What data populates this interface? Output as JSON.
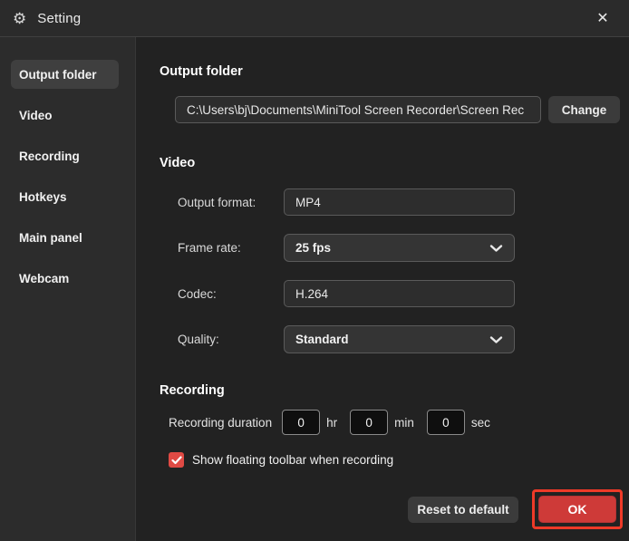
{
  "window": {
    "title": "Setting",
    "gear_icon": "gear",
    "close_icon": "close"
  },
  "colors": {
    "titlebar_bg": "#2b2b2b",
    "sidebar_bg": "#2c2c2c",
    "content_bg": "#222222",
    "selected_item_bg": "#3f3f3f",
    "accent_red": "#ce3a38",
    "checkbox_red": "#e04a44",
    "annotation_red": "#ee3a28"
  },
  "sidebar": {
    "items": [
      {
        "label": "Output folder",
        "selected": true
      },
      {
        "label": "Video",
        "selected": false
      },
      {
        "label": "Recording",
        "selected": false
      },
      {
        "label": "Hotkeys",
        "selected": false
      },
      {
        "label": "Main panel",
        "selected": false
      },
      {
        "label": "Webcam",
        "selected": false
      }
    ]
  },
  "output_folder_section": {
    "heading": "Output folder",
    "path_value": "C:\\Users\\bj\\Documents\\MiniTool Screen Recorder\\Screen Rec",
    "change_button": "Change"
  },
  "video_section": {
    "heading": "Video",
    "rows": [
      {
        "label": "Output format:",
        "value": "MP4",
        "type": "input"
      },
      {
        "label": "Frame rate:",
        "value": "25 fps",
        "type": "dropdown"
      },
      {
        "label": "Codec:",
        "value": "H.264",
        "type": "input"
      },
      {
        "label": "Quality:",
        "value": "Standard",
        "type": "dropdown"
      }
    ]
  },
  "recording_section": {
    "heading": "Recording",
    "duration_label": "Recording duration",
    "hours": "0",
    "hr_unit": "hr",
    "minutes": "0",
    "min_unit": "min",
    "seconds": "0",
    "sec_unit": "sec",
    "checkbox_checked": true,
    "checkbox_label": "Show floating toolbar when recording"
  },
  "footer": {
    "reset_button": "Reset to default",
    "ok_button": "OK"
  }
}
